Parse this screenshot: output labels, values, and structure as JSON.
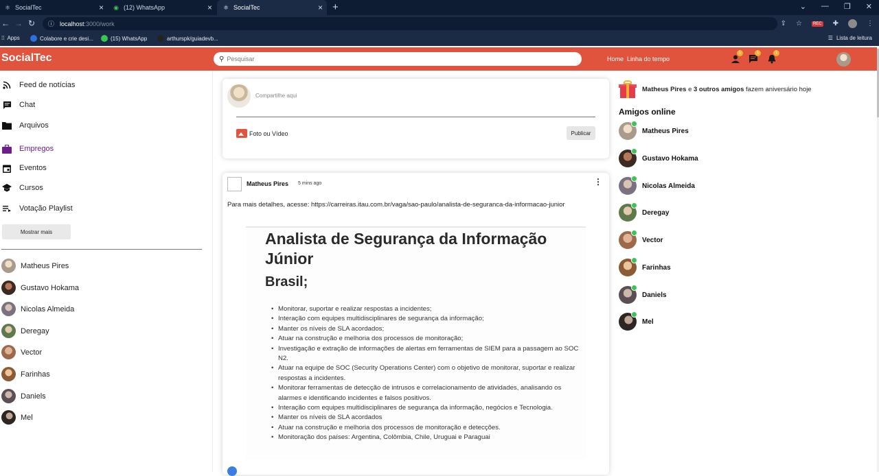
{
  "browser": {
    "tabs": [
      {
        "title": "SocialTec",
        "icon": "react-icon"
      },
      {
        "title": "(12) WhatsApp",
        "icon": "whatsapp-icon"
      },
      {
        "title": "SocialTec",
        "icon": "react-icon"
      }
    ],
    "url_host": "localhost",
    "url_path": ":3000/work",
    "bookmarks": [
      "Apps",
      "Colabore e crie desi...",
      "(15) WhatsApp",
      "arthurspk/guiadevb..."
    ],
    "reading_list": "Lista de leitura",
    "rec_badge": "REC"
  },
  "app": {
    "logo": "SocialTec",
    "search_placeholder": "Pesquisar",
    "nav_links": [
      "Home",
      "Linha do tempo"
    ],
    "badges": {
      "users": "1",
      "messages": "1",
      "notifications": "1"
    },
    "accent_color": "#e0533c"
  },
  "sidebar": {
    "items": [
      {
        "label": "Feed de notícias",
        "icon": "rss-icon"
      },
      {
        "label": "Chat",
        "icon": "chat-icon"
      },
      {
        "label": "Arquivos",
        "icon": "folder-icon"
      },
      {
        "label": "Empregos",
        "icon": "briefcase-icon",
        "active": true
      },
      {
        "label": "Eventos",
        "icon": "calendar-icon"
      },
      {
        "label": "Cursos",
        "icon": "school-icon"
      },
      {
        "label": "Votação Playlist",
        "icon": "playlist-icon"
      }
    ],
    "more_button": "Mostrar mais",
    "friends": [
      "Matheus Pires",
      "Gustavo Hokama",
      "Nicolas Almeida",
      "Deregay",
      "Vector",
      "Farinhas",
      "Daniels",
      "Mel"
    ]
  },
  "share": {
    "placeholder": "Compartilhe aqui",
    "media_label": "Foto ou Vídeo",
    "publish_label": "Publicar"
  },
  "post": {
    "author": "Matheus Pires",
    "time": "5 mins ago",
    "text": "Para mais detalhes, acesse: https://carreiras.itau.com.br/vaga/sao-paulo/analista-de-seguranca-da-informacao-junior",
    "image_title": "Analista de Segurança da Informação Júnior",
    "image_subtitle": "Brasil;",
    "image_bullets": [
      "Monitorar, suportar e realizar respostas a incidentes;",
      "Interação com equipes multidisciplinares de segurança da informação;",
      "Manter os níveis de SLA acordados;",
      "Atuar na construção e melhoria dos processos de monitoração;",
      "Investigação e extração de informações de alertas em ferramentas de SIEM para a passagem ao SOC N2.",
      "Atuar na equipe de SOC (Security Operations Center) com o objetivo de monitorar, suportar e realizar respostas a incidentes.",
      "Monitorar ferramentas de detecção de intrusos e correlacionamento de atividades, analisando os alarmes e identificando incidentes e falsos positivos.",
      "Interação com equipes multidisciplinares de segurança da informação, negócios e Tecnologia.",
      "Manter os níveis de SLA acordados",
      "Atuar na construção e melhoria dos processos de monitoração e detecções.",
      "Monitoração dos países: Argentina, Colômbia, Chile, Uruguai e Paraguai"
    ]
  },
  "right": {
    "birthday": {
      "name": "Matheus Pires",
      "connector": "e",
      "others": "3 outros amigos",
      "suffix": "fazem aniversário hoje"
    },
    "online_title": "Amigos online",
    "online_friends": [
      "Matheus Pires",
      "Gustavo Hokama",
      "Nicolas Almeida",
      "Deregay",
      "Vector",
      "Farinhas",
      "Daniels",
      "Mel"
    ],
    "online_color": "#3bc454"
  }
}
